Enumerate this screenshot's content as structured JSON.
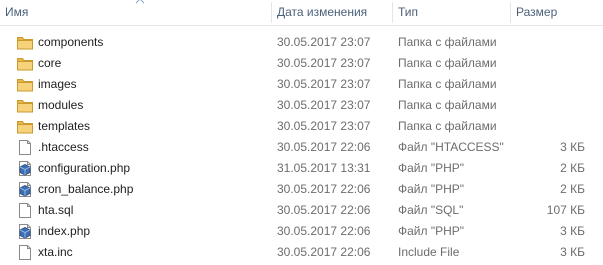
{
  "header": {
    "name": "Имя",
    "date": "Дата изменения",
    "type": "Тип",
    "size": "Размер"
  },
  "files": [
    {
      "name": "components",
      "icon": "folder-icon",
      "date": "30.05.2017 23:07",
      "type": "Папка с файлами",
      "size": ""
    },
    {
      "name": "core",
      "icon": "folder-icon",
      "date": "30.05.2017 23:07",
      "type": "Папка с файлами",
      "size": ""
    },
    {
      "name": "images",
      "icon": "folder-icon",
      "date": "30.05.2017 23:07",
      "type": "Папка с файлами",
      "size": ""
    },
    {
      "name": "modules",
      "icon": "folder-icon",
      "date": "30.05.2017 23:07",
      "type": "Папка с файлами",
      "size": ""
    },
    {
      "name": "templates",
      "icon": "folder-icon",
      "date": "30.05.2017 23:07",
      "type": "Папка с файлами",
      "size": ""
    },
    {
      "name": ".htaccess",
      "icon": "file-icon",
      "date": "30.05.2017 22:06",
      "type": "Файл \"HTACCESS\"",
      "size": "3 КБ"
    },
    {
      "name": "configuration.php",
      "icon": "php-file-icon",
      "date": "31.05.2017 13:31",
      "type": "Файл \"PHP\"",
      "size": "2 КБ"
    },
    {
      "name": "cron_balance.php",
      "icon": "php-file-icon",
      "date": "30.05.2017 22:06",
      "type": "Файл \"PHP\"",
      "size": "2 КБ"
    },
    {
      "name": "hta.sql",
      "icon": "file-icon",
      "date": "30.05.2017 22:06",
      "type": "Файл \"SQL\"",
      "size": "107 КБ"
    },
    {
      "name": "index.php",
      "icon": "php-file-icon",
      "date": "30.05.2017 22:06",
      "type": "Файл \"PHP\"",
      "size": "3 КБ"
    },
    {
      "name": "xta.inc",
      "icon": "file-icon",
      "date": "30.05.2017 22:06",
      "type": "Include File",
      "size": "3 КБ"
    }
  ]
}
